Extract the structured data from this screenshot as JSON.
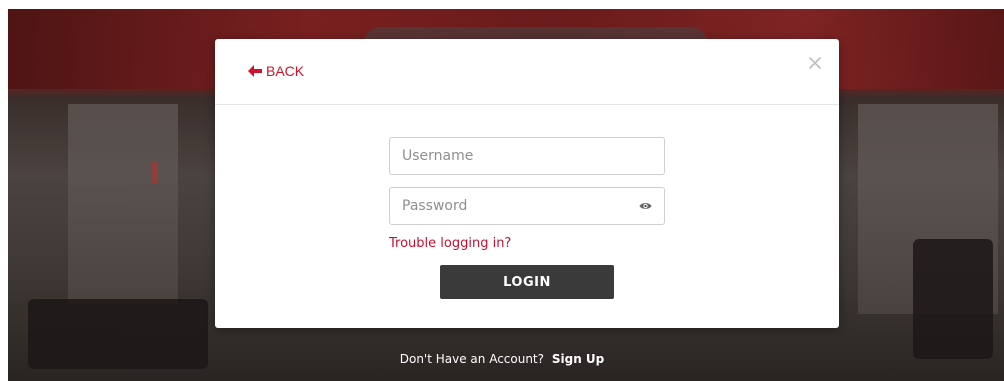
{
  "modal": {
    "back_label": "BACK",
    "close_symbol": "×"
  },
  "form": {
    "username_placeholder": "Username",
    "password_placeholder": "Password",
    "trouble_label": "Trouble logging in?",
    "login_label": "LOGIN"
  },
  "footer": {
    "prompt": "Don't Have an Account?",
    "signup_label": "Sign Up"
  },
  "icons": {
    "back": "arrow-left-icon",
    "close": "close-icon",
    "show_password": "eye-icon"
  },
  "colors": {
    "accent": "#d0112b",
    "button": "#3a3a3a",
    "overlay_top": "#6b1b1b"
  }
}
